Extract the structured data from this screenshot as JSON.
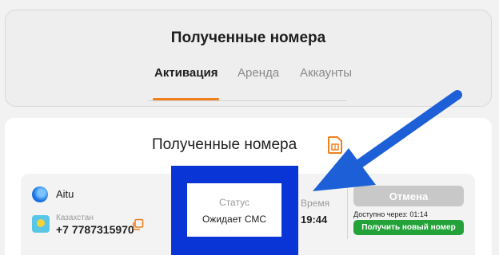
{
  "header": {
    "title": "Полученные номера",
    "tabs": [
      {
        "label": "Активация",
        "active": true
      },
      {
        "label": "Аренда",
        "active": false
      },
      {
        "label": "Аккаунты",
        "active": false
      }
    ]
  },
  "main": {
    "title": "Полученные номера",
    "order": {
      "service": "Aitu",
      "country": "Казахстан",
      "phone": "+7 7787315970",
      "status_label": "Статус",
      "status_value": "Ожидает СМС",
      "time_label": "Время",
      "time_value": "19:44",
      "cancel_label": "Отмена",
      "available_text": "Доступно через: 01:14",
      "new_number_label": "Получить новый номер"
    }
  },
  "colors": {
    "accent": "#f07f1e",
    "highlight_box": "#0a35d6",
    "arrow": "#1d5fd6",
    "success": "#22a238",
    "disabled": "#c8c8c8"
  },
  "icons": [
    "sim-card-icon",
    "copy-icon",
    "aitu-logo",
    "kazakhstan-flag-icon"
  ]
}
